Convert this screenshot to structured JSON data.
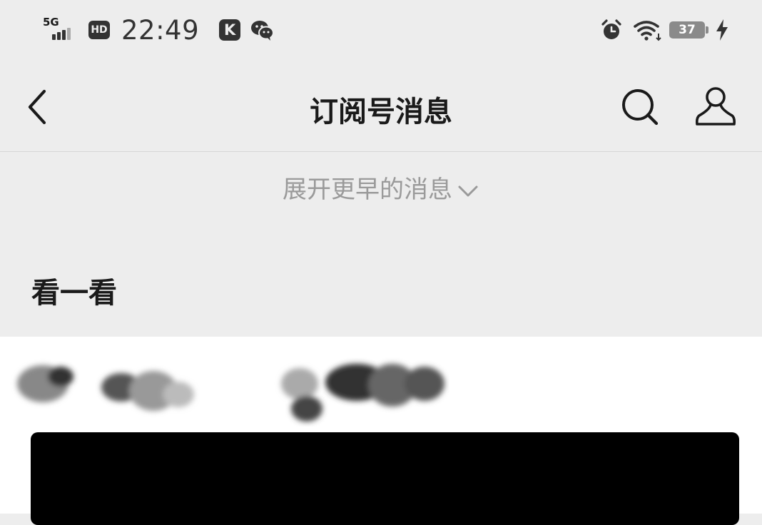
{
  "status_bar": {
    "network": "5G",
    "hd_label": "HD",
    "time": "22:49",
    "app_badge": "K",
    "battery": "37",
    "icons": [
      "signal-icon",
      "hd-icon",
      "k-app-icon",
      "wechat-icon",
      "alarm-icon",
      "wifi-icon",
      "battery-icon",
      "charging-icon"
    ]
  },
  "nav": {
    "title": "订阅号消息",
    "icons": [
      "back-chevron-icon",
      "search-icon",
      "profile-icon"
    ]
  },
  "feed": {
    "expand_label": "展开更早的消息",
    "section_title": "看一看"
  },
  "colors": {
    "background": "#ededed",
    "card": "#ffffff",
    "text": "#1a1a1a",
    "muted": "#9a9a9a"
  }
}
